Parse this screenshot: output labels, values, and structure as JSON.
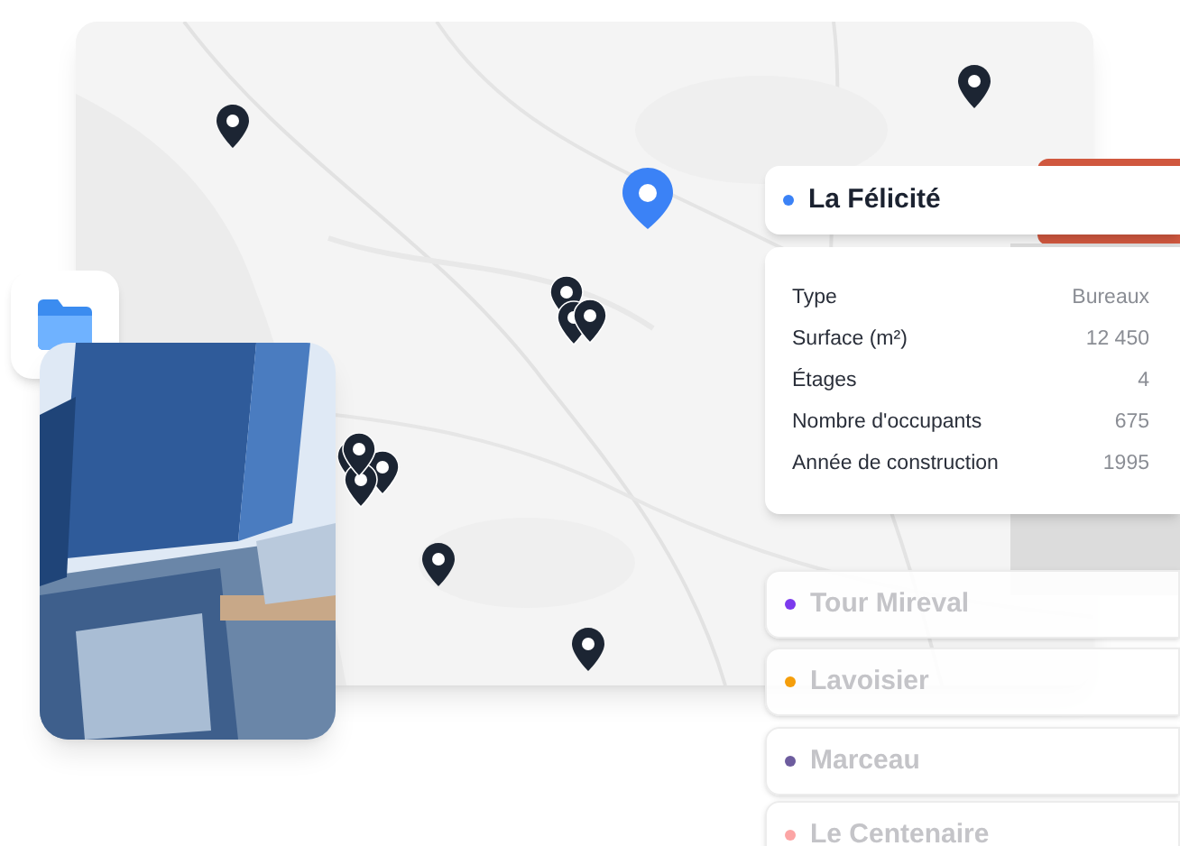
{
  "buildings": [
    {
      "name": "La Félicité",
      "color": "#3b82f6",
      "selected": true,
      "details": [
        {
          "label": "Type",
          "value": "Bureaux"
        },
        {
          "label": "Surface (m²)",
          "value": "12 450"
        },
        {
          "label": "Étages",
          "value": "4"
        },
        {
          "label": "Nombre d'occupants",
          "value": "675"
        },
        {
          "label": "Année de construction",
          "value": "1995"
        }
      ]
    },
    {
      "name": "Tour Mireval",
      "color": "#7c3aed",
      "selected": false
    },
    {
      "name": "Lavoisier",
      "color": "#f59e0b",
      "selected": false
    },
    {
      "name": "Marceau",
      "color": "#6d5c9e",
      "selected": false
    },
    {
      "name": "Le Centenaire",
      "color": "#fca5a5",
      "selected": false
    }
  ]
}
